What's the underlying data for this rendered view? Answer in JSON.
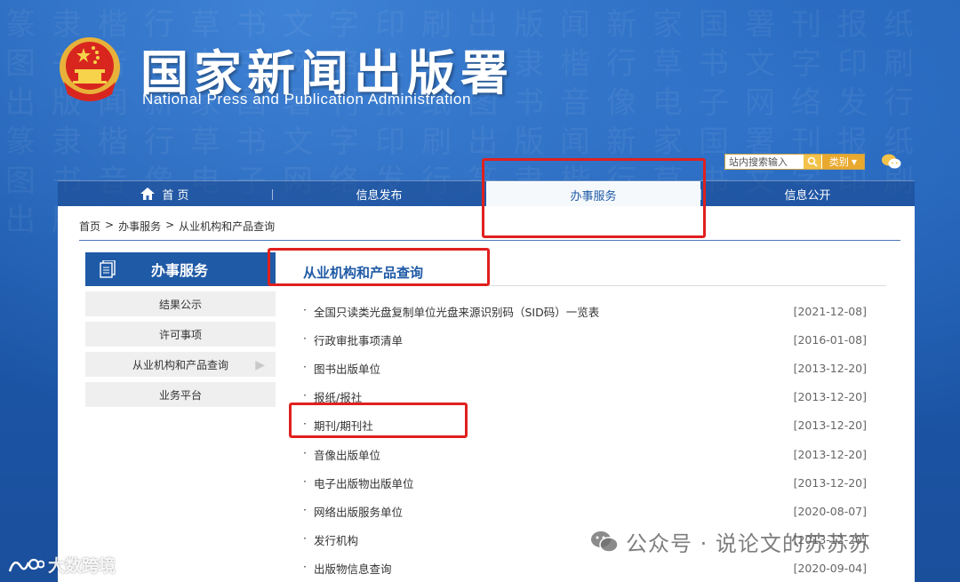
{
  "header": {
    "title": "国家新闻出版署",
    "subtitle": "National  Press and Publication Administration",
    "search_placeholder": "站内搜索输入",
    "category_label": "类别"
  },
  "nav": {
    "items": [
      {
        "label": "首 页"
      },
      {
        "label": "信息发布"
      },
      {
        "label": "办事服务"
      },
      {
        "label": "信息公开"
      }
    ]
  },
  "breadcrumb": [
    "首页",
    ">",
    "办事服务",
    ">",
    "从业机构和产品查询"
  ],
  "sidebar": {
    "title": "办事服务",
    "items": [
      "结果公示",
      "许可事项",
      "从业机构和产品查询",
      "业务平台"
    ]
  },
  "main": {
    "title": "从业机构和产品查询",
    "bullet": "·",
    "items": [
      {
        "text": "全国只读类光盘复制单位光盘来源识别码（SID码）一览表",
        "date": "[2021-12-08]"
      },
      {
        "text": "行政审批事项清单",
        "date": "[2016-01-08]"
      },
      {
        "text": "图书出版单位",
        "date": "[2013-12-20]"
      },
      {
        "text": "报纸/报社",
        "date": "[2013-12-20]"
      },
      {
        "text": "期刊/期刊社",
        "date": "[2013-12-20]"
      },
      {
        "text": "音像出版单位",
        "date": "[2013-12-20]"
      },
      {
        "text": "电子出版物出版单位",
        "date": "[2013-12-20]"
      },
      {
        "text": "网络出版服务单位",
        "date": "[2020-08-07]"
      },
      {
        "text": "发行机构",
        "date": "[2013-12-20]"
      },
      {
        "text": "出版物信息查询",
        "date": "[2020-09-04]"
      }
    ]
  },
  "watermarks": {
    "right": "公众号 · 说论文的苏苏苏",
    "left": "大数跨境"
  },
  "colors": {
    "brand_blue": "#1f5aa6",
    "annotation_red": "#e0201e",
    "accent_gold": "#e9a92e"
  }
}
